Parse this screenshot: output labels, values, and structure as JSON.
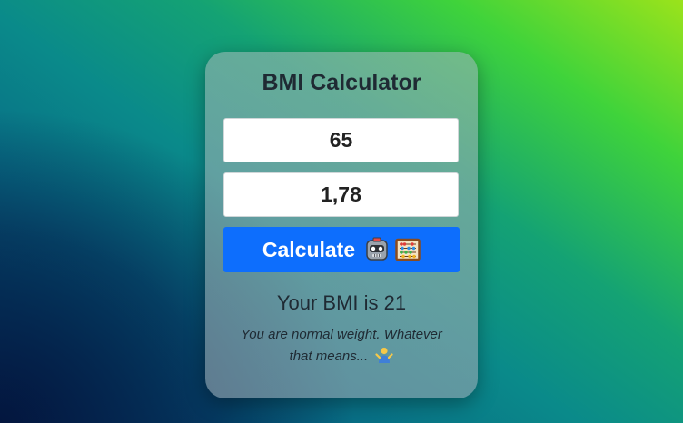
{
  "app": {
    "title": "BMI Calculator"
  },
  "form": {
    "weight_value": "65",
    "height_value": "1,78",
    "calculate_label": "Calculate",
    "calculate_icons": [
      "robot-icon",
      "abacus-icon"
    ]
  },
  "result": {
    "bmi_text": "Your BMI is 21",
    "note_text": "You are normal weight. Whatever that means...",
    "note_icon": "person-shrugging-icon"
  },
  "colors": {
    "button": "#0d6efd",
    "text": "#1f2a33"
  }
}
